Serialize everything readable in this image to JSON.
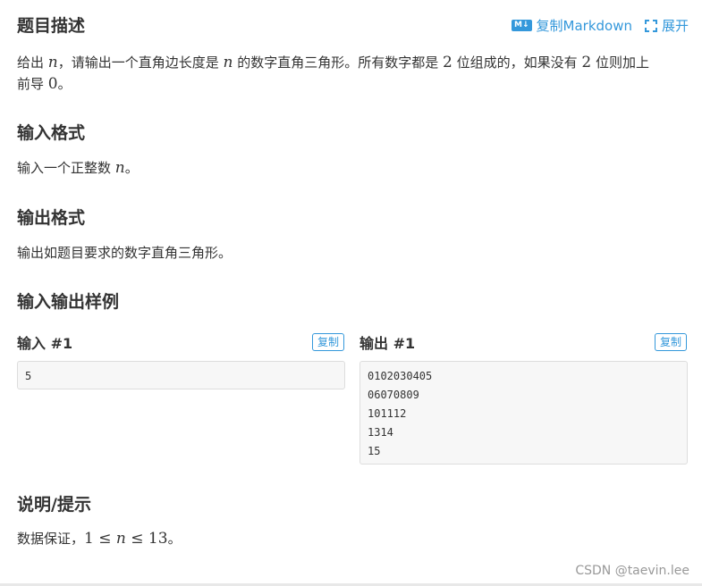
{
  "header": {
    "title": "题目描述",
    "copy_markdown_icon": "M↓",
    "copy_markdown_label": "复制Markdown",
    "expand_label": "展开"
  },
  "description": {
    "t1": "给出 ",
    "m1": "n",
    "t2": "，请输出一个直角边长度是 ",
    "m2": "n",
    "t3": " 的数字直角三角形。所有数字都是 ",
    "m3": "2",
    "t4": " 位组成的，如果没有 ",
    "m4": "2",
    "t5": " 位则加上",
    "t6": "前导 ",
    "m5": "0",
    "t7": "。"
  },
  "input_format": {
    "title": "输入格式",
    "t1": "输入一个正整数 ",
    "m1": "n",
    "t2": "。"
  },
  "output_format": {
    "title": "输出格式",
    "text": "输出如题目要求的数字直角三角形。"
  },
  "samples": {
    "title": "输入输出样例",
    "input_label": "输入 #1",
    "output_label": "输出 #1",
    "copy_label": "复制",
    "input_lines": [
      "5"
    ],
    "output_lines": [
      "0102030405",
      "06070809",
      "101112",
      "1314",
      "15"
    ]
  },
  "hint": {
    "title": "说明/提示",
    "t1": "数据保证，",
    "m1": "1",
    "op1": " ≤ ",
    "m2": "n",
    "op2": " ≤ ",
    "m3": "13",
    "t2": "。"
  },
  "watermark": "CSDN @taevin.lee",
  "colors": {
    "accent": "#3498db",
    "text": "#333333",
    "code_bg": "#f7f7f7",
    "code_border": "#dddddd"
  }
}
